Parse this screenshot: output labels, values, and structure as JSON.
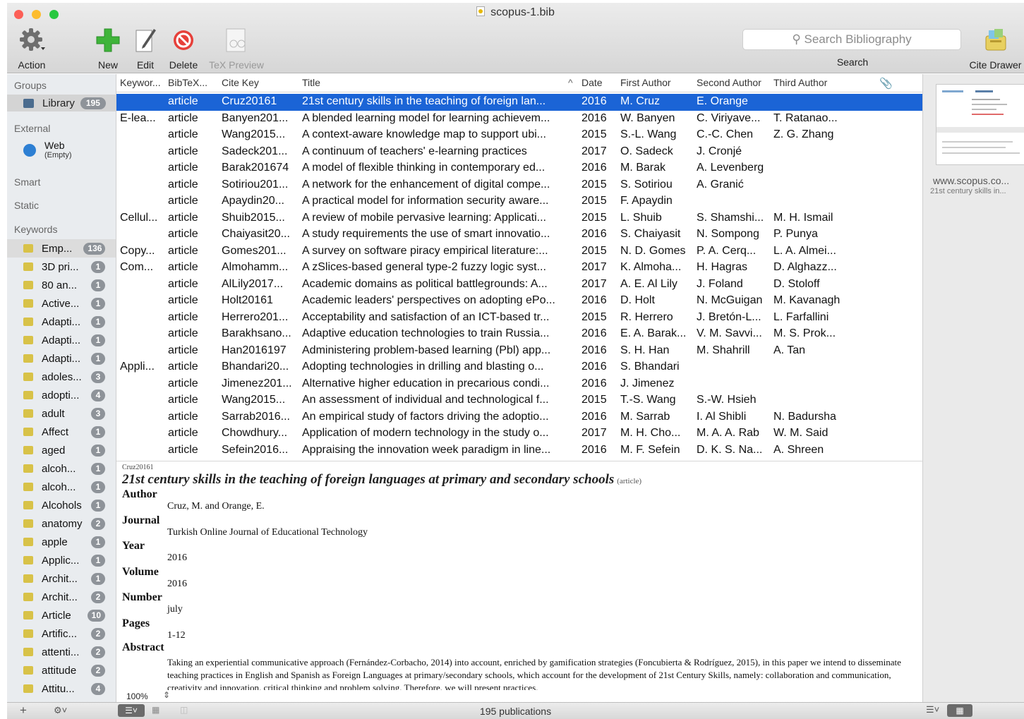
{
  "window": {
    "title": "scopus-1.bib"
  },
  "toolbar": {
    "action_label": "Action",
    "new_label": "New",
    "edit_label": "Edit",
    "delete_label": "Delete",
    "tex_preview_label": "TeX Preview",
    "search_placeholder": "Search Bibliography",
    "search_label": "Search",
    "cite_drawer_label": "Cite Drawer"
  },
  "sidebar": {
    "groups_header": "Groups",
    "library": {
      "label": "Library",
      "count": "195"
    },
    "external_header": "External",
    "web": {
      "label": "Web",
      "sub": "(Empty)"
    },
    "smart_header": "Smart",
    "static_header": "Static",
    "keywords_header": "Keywords",
    "keywords": [
      {
        "label": "Emp...",
        "count": "136"
      },
      {
        "label": "3D pri...",
        "count": "1"
      },
      {
        "label": "80 an...",
        "count": "1"
      },
      {
        "label": "Active...",
        "count": "1"
      },
      {
        "label": "Adapti...",
        "count": "1"
      },
      {
        "label": "Adapti...",
        "count": "1"
      },
      {
        "label": "Adapti...",
        "count": "1"
      },
      {
        "label": "adoles...",
        "count": "3"
      },
      {
        "label": "adopti...",
        "count": "4"
      },
      {
        "label": "adult",
        "count": "3"
      },
      {
        "label": "Affect",
        "count": "1"
      },
      {
        "label": "aged",
        "count": "1"
      },
      {
        "label": "alcoh...",
        "count": "1"
      },
      {
        "label": "alcoh...",
        "count": "1"
      },
      {
        "label": "Alcohols",
        "count": "1"
      },
      {
        "label": "anatomy",
        "count": "2"
      },
      {
        "label": "apple",
        "count": "1"
      },
      {
        "label": "Applic...",
        "count": "1"
      },
      {
        "label": "Archit...",
        "count": "1"
      },
      {
        "label": "Archit...",
        "count": "2"
      },
      {
        "label": "Article",
        "count": "10"
      },
      {
        "label": "Artific...",
        "count": "2"
      },
      {
        "label": "attenti...",
        "count": "2"
      },
      {
        "label": "attitude",
        "count": "2"
      },
      {
        "label": "Attitu...",
        "count": "4"
      }
    ]
  },
  "table": {
    "headers": [
      "Keywor...",
      "BibTeX...",
      "Cite Key",
      "Title",
      "Date",
      "First Author",
      "Second Author",
      "Third Author"
    ],
    "rows": [
      {
        "kw": "",
        "type": "article",
        "key": "Cruz20161",
        "title": "21st century skills in the teaching of foreign lan...",
        "date": "2016",
        "a1": "M. Cruz",
        "a2": "E. Orange",
        "a3": ""
      },
      {
        "kw": "E-lea...",
        "type": "article",
        "key": "Banyen201...",
        "title": "A blended learning model for learning achievem...",
        "date": "2016",
        "a1": "W. Banyen",
        "a2": "C. Viriyave...",
        "a3": "T. Ratanao..."
      },
      {
        "kw": "",
        "type": "article",
        "key": "Wang2015...",
        "title": "A context-aware knowledge map to support ubi...",
        "date": "2015",
        "a1": "S.-L. Wang",
        "a2": "C.-C. Chen",
        "a3": "Z. G. Zhang"
      },
      {
        "kw": "",
        "type": "article",
        "key": "Sadeck201...",
        "title": "A continuum of teachers' e-learning practices",
        "date": "2017",
        "a1": "O. Sadeck",
        "a2": "J. Cronjé",
        "a3": ""
      },
      {
        "kw": "",
        "type": "article",
        "key": "Barak201674",
        "title": "A model of flexible thinking in contemporary ed...",
        "date": "2016",
        "a1": "M. Barak",
        "a2": "A. Levenberg",
        "a3": ""
      },
      {
        "kw": "",
        "type": "article",
        "key": "Sotiriou201...",
        "title": "A network for the enhancement of digital compe...",
        "date": "2015",
        "a1": "S. Sotiriou",
        "a2": "A. Granić",
        "a3": ""
      },
      {
        "kw": "",
        "type": "article",
        "key": "Apaydin20...",
        "title": "A practical model for information security aware...",
        "date": "2015",
        "a1": "F. Apaydin",
        "a2": "",
        "a3": ""
      },
      {
        "kw": "Cellul...",
        "type": "article",
        "key": "Shuib2015...",
        "title": "A review of mobile pervasive learning: Applicati...",
        "date": "2015",
        "a1": "L. Shuib",
        "a2": "S. Shamshi...",
        "a3": "M. H. Ismail"
      },
      {
        "kw": "",
        "type": "article",
        "key": "Chaiyasit20...",
        "title": "A study requirements the use of smart innovatio...",
        "date": "2016",
        "a1": "S. Chaiyasit",
        "a2": "N. Sompong",
        "a3": "P. Punya"
      },
      {
        "kw": "Copy...",
        "type": "article",
        "key": "Gomes201...",
        "title": "A survey on software piracy empirical literature:...",
        "date": "2015",
        "a1": "N. D. Gomes",
        "a2": "P. A. Cerq...",
        "a3": "L. A. Almei..."
      },
      {
        "kw": "Com...",
        "type": "article",
        "key": "Almohamm...",
        "title": "A zSlices-based general type-2 fuzzy logic syst...",
        "date": "2017",
        "a1": "K. Almoha...",
        "a2": "H. Hagras",
        "a3": "D. Alghazz..."
      },
      {
        "kw": "",
        "type": "article",
        "key": "AlLily2017...",
        "title": "Academic domains as political battlegrounds: A...",
        "date": "2017",
        "a1": "A. E. Al Lily",
        "a2": "J. Foland",
        "a3": "D. Stoloff"
      },
      {
        "kw": "",
        "type": "article",
        "key": "Holt20161",
        "title": "Academic leaders' perspectives on adopting ePo...",
        "date": "2016",
        "a1": "D. Holt",
        "a2": "N. McGuigan",
        "a3": "M. Kavanagh"
      },
      {
        "kw": "",
        "type": "article",
        "key": "Herrero201...",
        "title": "Acceptability and satisfaction of an ICT-based tr...",
        "date": "2015",
        "a1": "R. Herrero",
        "a2": "J. Bretón-L...",
        "a3": "L. Farfallini"
      },
      {
        "kw": "",
        "type": "article",
        "key": "Barakhsano...",
        "title": "Adaptive education technologies to train Russia...",
        "date": "2016",
        "a1": "E. A. Barak...",
        "a2": "V. M. Savvi...",
        "a3": "M. S. Prok..."
      },
      {
        "kw": "",
        "type": "article",
        "key": "Han2016197",
        "title": "Administering problem-based learning (Pbl) app...",
        "date": "2016",
        "a1": "S. H. Han",
        "a2": "M. Shahrill",
        "a3": "A. Tan"
      },
      {
        "kw": "Appli...",
        "type": "article",
        "key": "Bhandari20...",
        "title": "Adopting technologies in drilling and blasting o...",
        "date": "2016",
        "a1": "S. Bhandari",
        "a2": "",
        "a3": ""
      },
      {
        "kw": "",
        "type": "article",
        "key": "Jimenez201...",
        "title": "Alternative higher education in precarious condi...",
        "date": "2016",
        "a1": "J. Jimenez",
        "a2": "",
        "a3": ""
      },
      {
        "kw": "",
        "type": "article",
        "key": "Wang2015...",
        "title": "An assessment of individual and technological f...",
        "date": "2015",
        "a1": "T.-S. Wang",
        "a2": "S.-W. Hsieh",
        "a3": ""
      },
      {
        "kw": "",
        "type": "article",
        "key": "Sarrab2016...",
        "title": "An empirical study of factors driving the adoptio...",
        "date": "2016",
        "a1": "M. Sarrab",
        "a2": "I. Al Shibli",
        "a3": "N. Badursha"
      },
      {
        "kw": "",
        "type": "article",
        "key": "Chowdhury...",
        "title": "Application of modern technology in the study o...",
        "date": "2017",
        "a1": "M. H. Cho...",
        "a2": "M. A. A. Rab",
        "a3": "W. M. Said"
      },
      {
        "kw": "",
        "type": "article",
        "key": "Sefein2016...",
        "title": "Appraising the innovation week paradigm in line...",
        "date": "2016",
        "a1": "M. F. Sefein",
        "a2": "D. K. S. Na...",
        "a3": "A. Shreen"
      }
    ]
  },
  "detail": {
    "cite_key": "Cruz20161",
    "title": "21st century skills in the teaching of foreign languages at primary and secondary schools",
    "type": "(article)",
    "fields": [
      {
        "label": "Author",
        "value": "Cruz, M. and Orange, E."
      },
      {
        "label": "Journal",
        "value": "Turkish Online Journal of Educational Technology"
      },
      {
        "label": "Year",
        "value": "2016"
      },
      {
        "label": "Volume",
        "value": "2016"
      },
      {
        "label": "Number",
        "value": "july"
      },
      {
        "label": "Pages",
        "value": "1-12"
      }
    ],
    "abstract_label": "Abstract",
    "abstract": "Taking an experiential communicative approach (Fernández-Corbacho, 2014) into account, enriched by gamification strategies (Foncubierta & Rodríguez, 2015), in this paper we intend to disseminate teaching practices in English and Spanish as Foreign Languages at primary/secondary schools, which account for the development of 21st Century Skills, namely: collaboration and communication, creativity and innovation, critical thinking and problem solving. Therefore, we will present practices.",
    "zoom": "100%"
  },
  "right_pane": {
    "url": "www.scopus.co...",
    "subtitle": "21st century skills in..."
  },
  "status": {
    "count_text": "195 publications"
  },
  "colors": {
    "selection": "#1b64d6",
    "badge": "#8e9399",
    "folder": "#d8c248"
  }
}
